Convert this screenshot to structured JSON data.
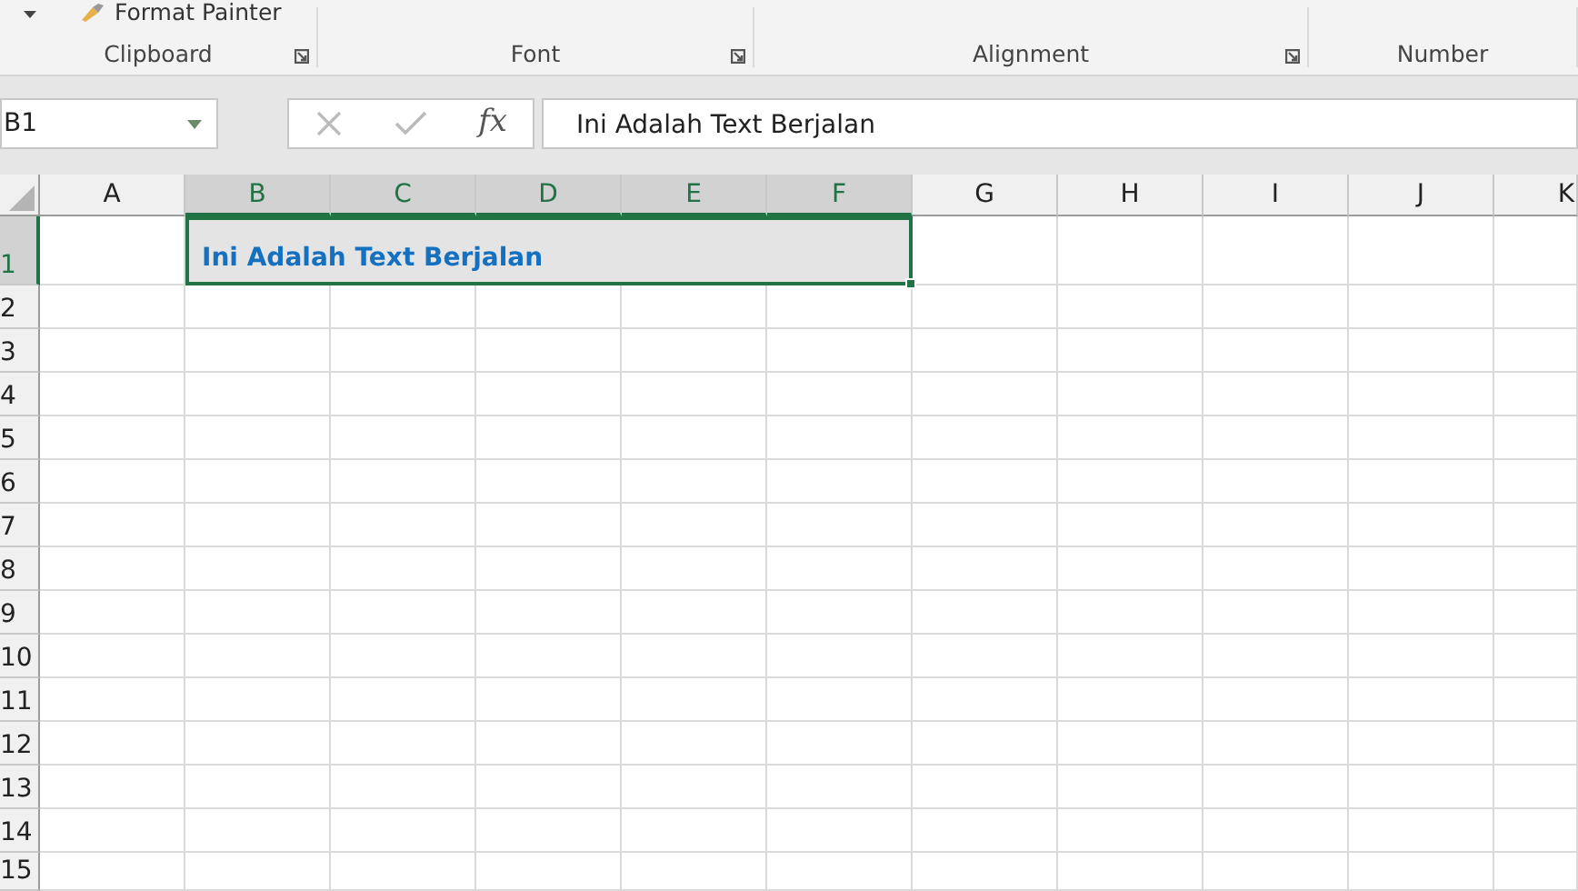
{
  "ribbon": {
    "clipboard_button": "Format Painter",
    "groups": [
      {
        "label": "Clipboard",
        "launcher": true
      },
      {
        "label": "Font",
        "launcher": true
      },
      {
        "label": "Alignment",
        "launcher": true
      },
      {
        "label": "Number",
        "launcher": false
      }
    ]
  },
  "formula_bar": {
    "name_box": "B1",
    "function_label": "fx",
    "value": "Ini Adalah Text Berjalan"
  },
  "sheet": {
    "columns": [
      {
        "label": "A",
        "selected": false
      },
      {
        "label": "B",
        "selected": true
      },
      {
        "label": "C",
        "selected": true
      },
      {
        "label": "D",
        "selected": true
      },
      {
        "label": "E",
        "selected": true
      },
      {
        "label": "F",
        "selected": true
      },
      {
        "label": "G",
        "selected": false
      },
      {
        "label": "H",
        "selected": false
      },
      {
        "label": "I",
        "selected": false
      },
      {
        "label": "J",
        "selected": false
      },
      {
        "label": "K",
        "selected": false
      }
    ],
    "rows": [
      {
        "label": "1",
        "selected": true
      },
      {
        "label": "2",
        "selected": false
      },
      {
        "label": "3",
        "selected": false
      },
      {
        "label": "4",
        "selected": false
      },
      {
        "label": "5",
        "selected": false
      },
      {
        "label": "6",
        "selected": false
      },
      {
        "label": "7",
        "selected": false
      },
      {
        "label": "8",
        "selected": false
      },
      {
        "label": "9",
        "selected": false
      },
      {
        "label": "10",
        "selected": false
      },
      {
        "label": "11",
        "selected": false
      },
      {
        "label": "12",
        "selected": false
      },
      {
        "label": "13",
        "selected": false
      },
      {
        "label": "14",
        "selected": false
      },
      {
        "label": "15",
        "selected": false
      }
    ],
    "merged_cell": {
      "text": "Ini Adalah Text Berjalan"
    }
  }
}
